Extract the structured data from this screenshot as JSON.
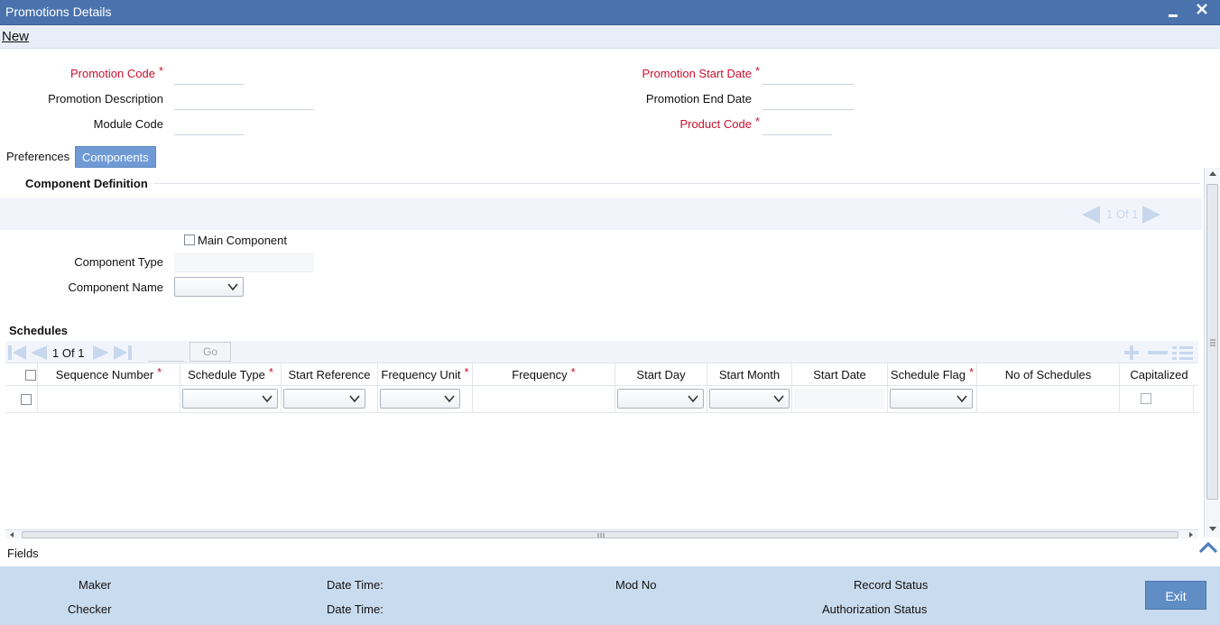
{
  "window": {
    "title": "Promotions Details"
  },
  "toolbar": {
    "new_label": "New"
  },
  "header": {
    "promotion_code": "Promotion Code",
    "promotion_description": "Promotion Description",
    "module_code": "Module Code",
    "promotion_start_date": "Promotion Start Date",
    "promotion_end_date": "Promotion End Date",
    "product_code": "Product Code",
    "required_mark": "*"
  },
  "tabs": [
    {
      "label": "Preferences",
      "active": false
    },
    {
      "label": "Components",
      "active": true
    }
  ],
  "component_definition": {
    "title": "Component Definition",
    "pager": "1 Of 1",
    "main_component": "Main Component",
    "component_type": "Component Type",
    "component_name": "Component Name"
  },
  "schedules": {
    "title": "Schedules",
    "page_current": "1",
    "page_of": "Of",
    "page_total": "1",
    "go_label": "Go",
    "columns": [
      {
        "label": "Sequence Number",
        "required": true
      },
      {
        "label": "Schedule Type",
        "required": true
      },
      {
        "label": "Start Reference",
        "required": false
      },
      {
        "label": "Frequency Unit",
        "required": true
      },
      {
        "label": "Frequency",
        "required": true
      },
      {
        "label": "Start Day",
        "required": false
      },
      {
        "label": "Start Month",
        "required": false
      },
      {
        "label": "Start Date",
        "required": false
      },
      {
        "label": "Schedule Flag",
        "required": true
      },
      {
        "label": "No of Schedules",
        "required": false
      },
      {
        "label": "Capitalized",
        "required": false
      }
    ]
  },
  "fields_bar": {
    "label": "Fields"
  },
  "footer": {
    "maker": "Maker",
    "checker": "Checker",
    "date_time_1": "Date Time:",
    "date_time_2": "Date Time:",
    "mod_no": "Mod No",
    "record_status": "Record Status",
    "authorization_status": "Authorization Status",
    "exit_label": "Exit"
  },
  "colors": {
    "title_bar": "#4a72ad",
    "required": "#c8102e",
    "footer": "#c9dbef",
    "active_tab": "#6f9ad6"
  }
}
